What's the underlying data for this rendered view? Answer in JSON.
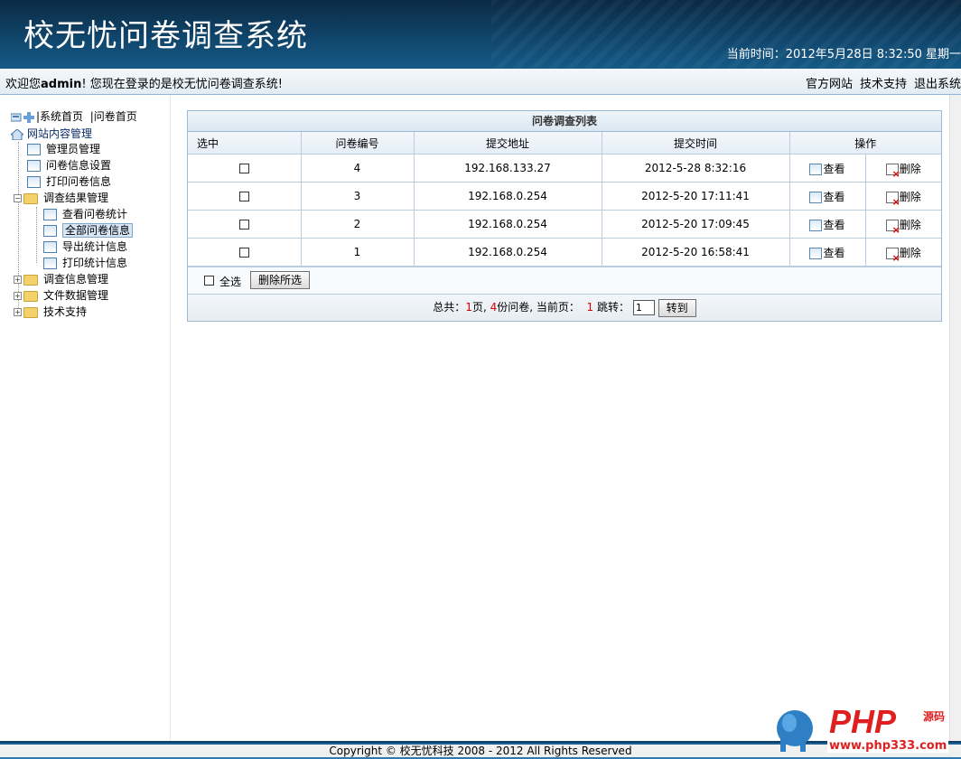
{
  "header": {
    "title": "校无忧问卷调查系统",
    "time": "当前时间：2012年5月28日  8:32:50 星期一"
  },
  "welcome": {
    "prefix": "欢迎您",
    "user": "admin",
    "suffix": "! 您现在登录的是校无忧问卷调查系统!",
    "links": [
      "官方网站",
      "技术支持",
      "退出系统"
    ]
  },
  "sidebar": {
    "top_links": [
      "系统首页",
      "问卷首页"
    ],
    "root": "网站内容管理",
    "items": [
      {
        "label": "管理员管理"
      },
      {
        "label": "问卷信息设置"
      },
      {
        "label": "打印问卷信息"
      },
      {
        "label": "调查结果管理"
      },
      {
        "label": "查看问卷统计"
      },
      {
        "label": "全部问卷信息"
      },
      {
        "label": "导出统计信息"
      },
      {
        "label": "打印统计信息"
      },
      {
        "label": "调查信息管理"
      },
      {
        "label": "文件数据管理"
      },
      {
        "label": "技术支持"
      }
    ]
  },
  "list": {
    "caption": "问卷调查列表",
    "columns": [
      "选中",
      "问卷编号",
      "提交地址",
      "提交时间",
      "操作"
    ],
    "rows": [
      {
        "id": "4",
        "ip": "192.168.133.27",
        "time": "2012-5-28 8:32:16",
        "view": "查看",
        "del": "删除"
      },
      {
        "id": "3",
        "ip": "192.168.0.254",
        "time": "2012-5-20 17:11:41",
        "view": "查看",
        "del": "删除"
      },
      {
        "id": "2",
        "ip": "192.168.0.254",
        "time": "2012-5-20 17:09:45",
        "view": "查看",
        "del": "删除"
      },
      {
        "id": "1",
        "ip": "192.168.0.254",
        "time": "2012-5-20 16:58:41",
        "view": "查看",
        "del": "删除"
      }
    ],
    "select_all": "全选",
    "delete_selected": "删除所选"
  },
  "pager": {
    "total_label": "总共：",
    "pages": "1",
    "pages_unit": "页,",
    "count": "4",
    "count_unit": "份问卷, 当前页：",
    "current": "1",
    "jump_label": "跳转：",
    "input_value": "1",
    "go_button": "转到"
  },
  "footer": {
    "copyright": "Copyright © 校无忧科技  2008 - 2012 All Rights Reserved"
  },
  "watermark": {
    "brand": "PHP",
    "tag": "源码",
    "url": "www.php333.com"
  }
}
